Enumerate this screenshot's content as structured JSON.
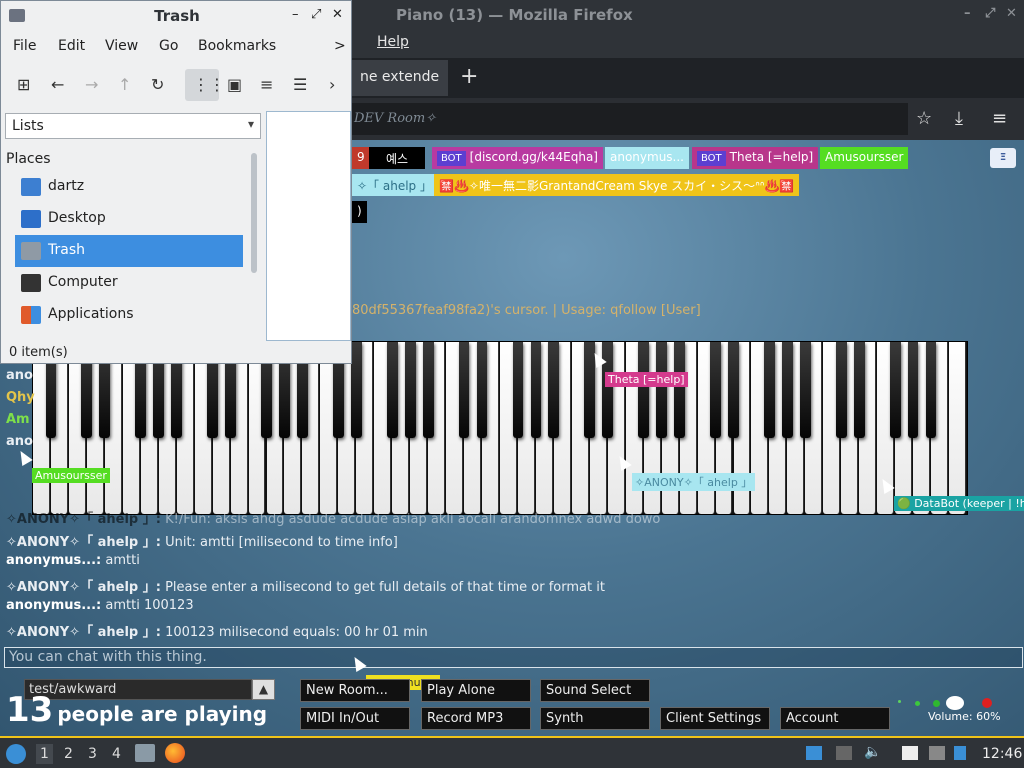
{
  "firefox": {
    "window_title": "Piano (13) — Mozilla Firefox",
    "menu_help": "Help",
    "tab_title": "ne extende",
    "new_tab": "+",
    "url_text": "DEV Room✧",
    "win_controls": [
      "–",
      "⤢",
      "✕"
    ]
  },
  "page": {
    "lang_button": "Ξ",
    "tags": [
      {
        "text": "9",
        "bg": "#c0392b"
      },
      {
        "text": "예스",
        "bg": "#000000"
      },
      {
        "bot": "BOT",
        "text": "[discord.gg/k44Eqha]",
        "bg": "#b83aa1"
      },
      {
        "text": "anonymus...",
        "bg": "#a8e6f0",
        "color": "#ffffff"
      },
      {
        "bot": "BOT",
        "text": "Theta [=help]",
        "bg": "#b8368b"
      },
      {
        "text": "Amusoursser",
        "bg": "#55dd22"
      },
      {
        "text": "✧「 ahelp 」",
        "bg": "#a8e6f0",
        "color": "#2c6f86"
      },
      {
        "text": "🈲♨️✧唯一無二影GrantandCream Skye スカイ・シス〜ᐢᐢ♨️🈲",
        "bg": "#f0c419"
      },
      {
        "text": ")",
        "bg": "#000000"
      }
    ],
    "follow_text": "80df55367feaf98fa2)'s cursor. | Usage: qfollow [User]",
    "cursor_labels": [
      {
        "text": "Theta [=help]",
        "bg": "#d43a8d",
        "color": "#ffffff"
      },
      {
        "text": "✧ANONY✧「 ahelp 」",
        "bg": "#a8e6f0",
        "color": "#4a8aa0"
      },
      {
        "text": "🟢 DataBot (keeper | !help",
        "bg": "#1aa3a3",
        "color": "#ffffff"
      },
      {
        "text": "Amusoursser",
        "bg": "#55dd22",
        "color": "#ffffff"
      },
      {
        "text": "anonymus...",
        "bg": "#f0e020",
        "color": "#333333"
      }
    ],
    "chat_partial_names": [
      "ano",
      "Qhy",
      "Am",
      "ano"
    ],
    "chat": [
      {
        "name": "✧ANONY✧「 ahelp 」:",
        "msg": "K!/Fun: aksis ahdg asdude acdude asiap akli aocali arandomnex adwd dowo",
        "name_color": "#e9eef3"
      },
      {
        "name": "✧ANONY✧「 ahelp 」:",
        "msg": "Unit: amtti [milisecond to time info]",
        "name_color": "#e9eef3"
      },
      {
        "name": "anonymus...:",
        "msg": "amtti",
        "name_color": "#ffffff"
      },
      {
        "name": "✧ANONY✧「 ahelp 」:",
        "msg": "Please enter a milisecond to get full details of that time or format it",
        "name_color": "#e9eef3"
      },
      {
        "name": "anonymus...:",
        "msg": "amtti 100123",
        "name_color": "#ffffff"
      },
      {
        "name": "✧ANONY✧「 ahelp 」:",
        "msg": "100123 milisecond equals: 00 hr 01 min",
        "name_color": "#e9eef3"
      }
    ],
    "chat_placeholder": "You can chat with this thing.",
    "room_name": "test/awkward",
    "room_arrow": "▲",
    "players_count": "13",
    "players_text": "people are playing",
    "buttons": {
      "new_room": "New Room...",
      "play_alone": "Play Alone",
      "sound_select": "Sound Select",
      "midi": "MIDI In/Out",
      "record": "Record MP3",
      "synth": "Synth",
      "client_settings": "Client Settings",
      "account": "Account"
    },
    "volume": "Volume: 60%",
    "volume_level": 0.6
  },
  "file_manager": {
    "title": "Trash",
    "menu": [
      "File",
      "Edit",
      "View",
      "Go",
      "Bookmarks"
    ],
    "menu_more": ">",
    "win_controls": [
      "–",
      "⤢",
      "✕"
    ],
    "combo_value": "Lists",
    "places_heading": "Places",
    "places": [
      {
        "label": "dartz",
        "icon_color": "#3d7fd1"
      },
      {
        "label": "Desktop",
        "icon_color": "#2d6fc9"
      },
      {
        "label": "Trash",
        "icon_color": "#8f9aa5",
        "selected": true
      },
      {
        "label": "Computer",
        "icon_color": "#333333"
      },
      {
        "label": "Applications",
        "icon_color": "#e05a2b"
      }
    ],
    "status": "0 item(s)"
  },
  "taskbar": {
    "workspaces": [
      "1",
      "2",
      "3",
      "4"
    ],
    "clock": "12:46"
  }
}
